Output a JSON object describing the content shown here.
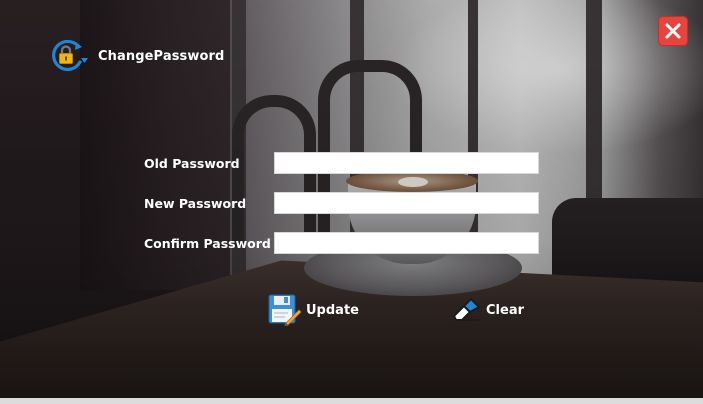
{
  "window": {
    "title": "ChangePassword"
  },
  "icons": {
    "title": "lock-refresh-icon",
    "close": "close-icon",
    "update": "floppy-disk-pencil-icon",
    "clear": "eraser-icon"
  },
  "colors": {
    "close_button": "#e6453f",
    "icon_blue": "#1f86d6",
    "lock_gold": "#f1b317"
  },
  "form": {
    "old_password": {
      "label": "Old Password",
      "value": ""
    },
    "new_password": {
      "label": "New Password",
      "value": ""
    },
    "confirm_password": {
      "label": "Confirm Password",
      "value": ""
    }
  },
  "actions": {
    "update_label": "Update",
    "clear_label": "Clear"
  }
}
